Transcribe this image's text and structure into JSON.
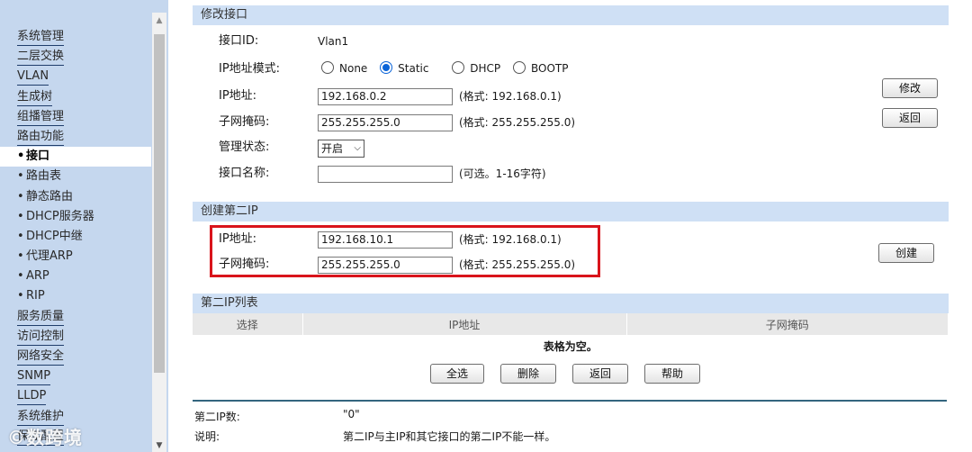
{
  "sidebar": {
    "items": [
      {
        "label": "系统管理",
        "sub": false,
        "active": false
      },
      {
        "label": "二层交换",
        "sub": false,
        "active": false
      },
      {
        "label": "VLAN",
        "sub": false,
        "active": false
      },
      {
        "label": "生成树",
        "sub": false,
        "active": false
      },
      {
        "label": "组播管理",
        "sub": false,
        "active": false
      },
      {
        "label": "路由功能",
        "sub": false,
        "active": false
      },
      {
        "label": "接口",
        "sub": true,
        "active": true
      },
      {
        "label": "路由表",
        "sub": true,
        "active": false
      },
      {
        "label": "静态路由",
        "sub": true,
        "active": false
      },
      {
        "label": "DHCP服务器",
        "sub": true,
        "active": false
      },
      {
        "label": "DHCP中继",
        "sub": true,
        "active": false
      },
      {
        "label": "代理ARP",
        "sub": true,
        "active": false
      },
      {
        "label": "ARP",
        "sub": true,
        "active": false
      },
      {
        "label": "RIP",
        "sub": true,
        "active": false
      },
      {
        "label": "服务质量",
        "sub": false,
        "active": false
      },
      {
        "label": "访问控制",
        "sub": false,
        "active": false
      },
      {
        "label": "网络安全",
        "sub": false,
        "active": false
      },
      {
        "label": "SNMP",
        "sub": false,
        "active": false
      },
      {
        "label": "LLDP",
        "sub": false,
        "active": false
      },
      {
        "label": "系统维护",
        "sub": false,
        "active": false
      },
      {
        "label": "保存配置",
        "sub": false,
        "active": false
      }
    ],
    "bullet": "•",
    "watermark": "©数跨境"
  },
  "modify": {
    "title": "修改接口",
    "interface_id_label": "接口ID:",
    "interface_id_value": "Vlan1",
    "ip_mode_label": "IP地址模式:",
    "ip_mode_options": [
      "None",
      "Static",
      "DHCP",
      "BOOTP"
    ],
    "ip_mode_selected": "Static",
    "ip_label": "IP地址:",
    "ip_value": "192.168.0.2",
    "ip_hint": "(格式:  192.168.0.1)",
    "mask_label": "子网掩码:",
    "mask_value": "255.255.255.0",
    "mask_hint": "(格式:  255.255.255.0)",
    "admin_label": "管理状态:",
    "admin_value": "开启",
    "name_label": "接口名称:",
    "name_value": "",
    "name_hint": "(可选。1-16字符)",
    "modify_button": "修改",
    "back_button": "返回"
  },
  "create": {
    "title": "创建第二IP",
    "ip_label": "IP地址:",
    "ip_value": "192.168.10.1",
    "ip_hint": "(格式:  192.168.0.1)",
    "mask_label": "子网掩码:",
    "mask_value": "255.255.255.0",
    "mask_hint": "(格式:  255.255.255.0)",
    "create_button": "创建"
  },
  "list": {
    "title": "第二IP列表",
    "columns": [
      "选择",
      "IP地址",
      "子网掩码"
    ],
    "empty_text": "表格为空。",
    "buttons": {
      "select_all": "全选",
      "delete": "删除",
      "back": "返回",
      "help": "帮助"
    }
  },
  "footer": {
    "count_label": "第二IP数:",
    "count_value": "\"0\"",
    "note_label": "说明:",
    "note_value": "第二IP与主IP和其它接口的第二IP不能一样。"
  },
  "colors": {
    "sidebar_bg": "#c5d7ee",
    "section_bar": "#cfe0f5",
    "highlight_box": "#d9141b",
    "radio_accent": "#0a64d8"
  }
}
